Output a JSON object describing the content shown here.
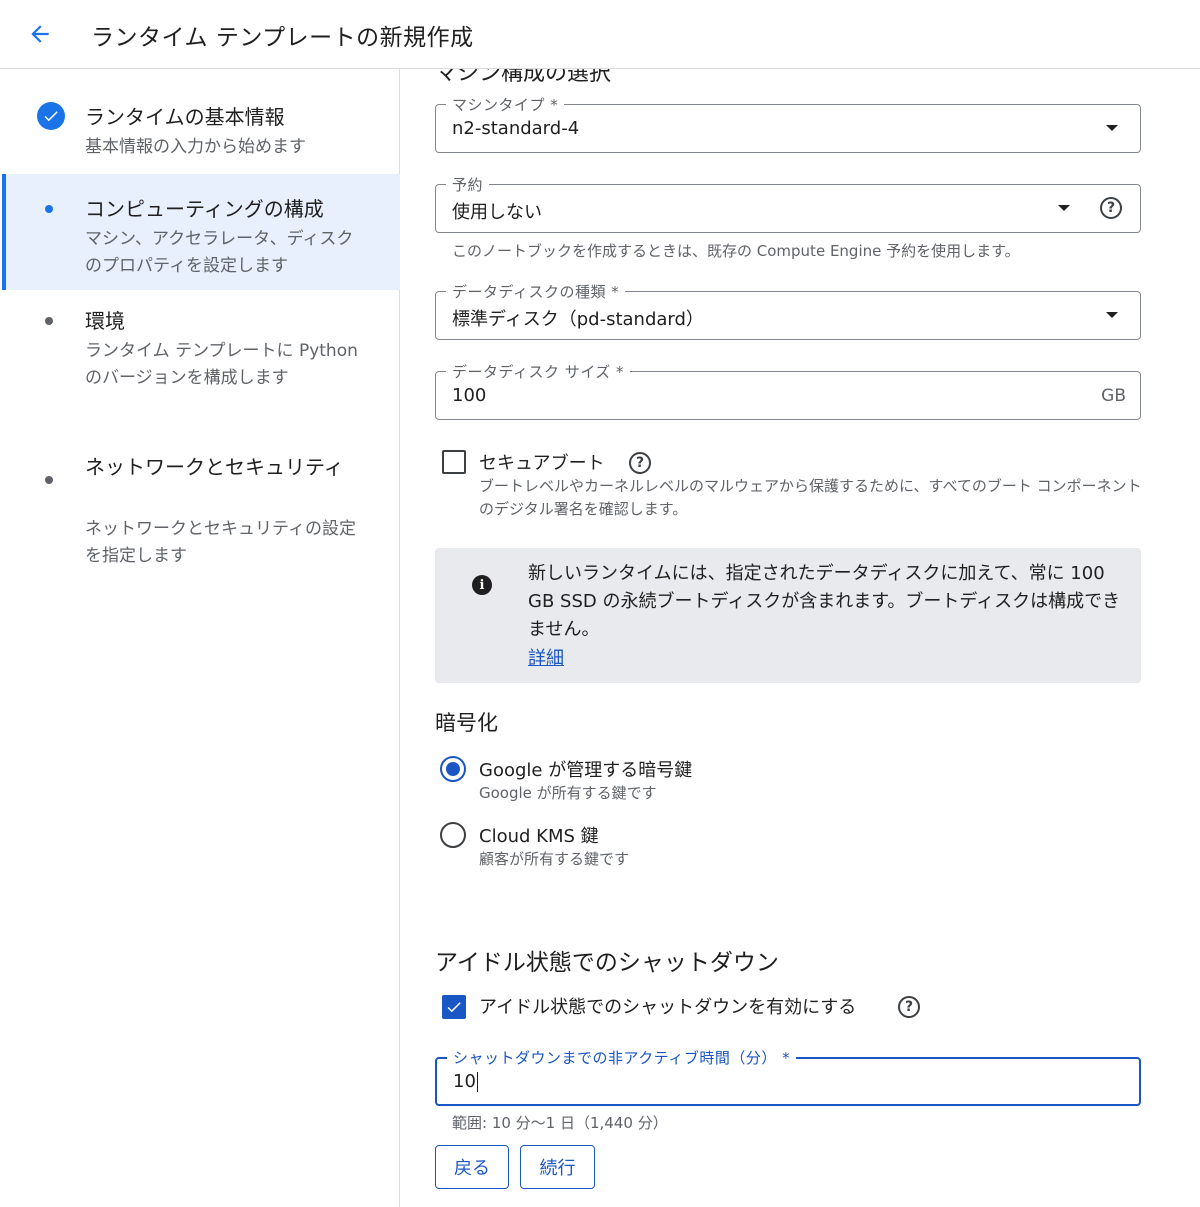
{
  "header": {
    "title": "ランタイム テンプレートの新規作成"
  },
  "sidebar": {
    "steps": [
      {
        "title": "ランタイムの基本情報",
        "desc": "基本情報の入力から始めます",
        "state": "completed"
      },
      {
        "title": "コンピューティングの構成",
        "desc": "マシン、アクセラレータ、ディスクのプロパティを設定します",
        "state": "active"
      },
      {
        "title": "環境",
        "desc": "ランタイム テンプレートに Python のバージョンを構成します",
        "state": "pending"
      },
      {
        "title": "ネットワークとセキュリティ",
        "desc": "ネットワークとセキュリティの設定を指定します",
        "state": "pending"
      }
    ]
  },
  "main": {
    "cut_heading": "マシン構成の選択",
    "machine_type": {
      "label": "マシンタイプ *",
      "value": "n2-standard-4"
    },
    "reservation": {
      "label": "予約",
      "value": "使用しない",
      "hint": "このノートブックを作成するときは、既存の Compute Engine 予約を使用します。"
    },
    "disk_type": {
      "label": "データディスクの種類 *",
      "value": "標準ディスク（pd-standard）"
    },
    "disk_size": {
      "label": "データディスク サイズ *",
      "value": "100",
      "suffix": "GB"
    },
    "secure_boot": {
      "label": "セキュアブート",
      "checked": false,
      "desc": "ブートレベルやカーネルレベルのマルウェアから保護するために、すべてのブート コンポーネントのデジタル署名を確認します。"
    },
    "info": {
      "text": "新しいランタイムには、指定されたデータディスクに加えて、常に 100 GB SSD の永続ブートディスクが含まれます。ブートディスクは構成できません。",
      "link": "詳細"
    },
    "encryption": {
      "title": "暗号化",
      "options": [
        {
          "label": "Google が管理する暗号鍵",
          "desc": "Google が所有する鍵です",
          "selected": true
        },
        {
          "label": "Cloud KMS 鍵",
          "desc": "顧客が所有する鍵です",
          "selected": false
        }
      ]
    },
    "idle_shutdown": {
      "title": "アイドル状態でのシャットダウン",
      "checkbox_label": "アイドル状態でのシャットダウンを有効にする",
      "checked": true,
      "field_label": "シャットダウンまでの非アクティブ時間（分） *",
      "value": "10",
      "range_hint": "範囲: 10 分〜1 日（1,440 分）"
    },
    "buttons": {
      "back": "戻る",
      "continue": "続行"
    }
  },
  "colors": {
    "accent": "#1a73e8",
    "focus": "#1a56c4",
    "active_step_bg": "#e8f0fe",
    "info_bg": "#e8eaed"
  },
  "icons": [
    "arrow-back-icon",
    "check-circle-icon",
    "dropdown-arrow-icon",
    "help-icon",
    "info-icon",
    "check-icon"
  ]
}
